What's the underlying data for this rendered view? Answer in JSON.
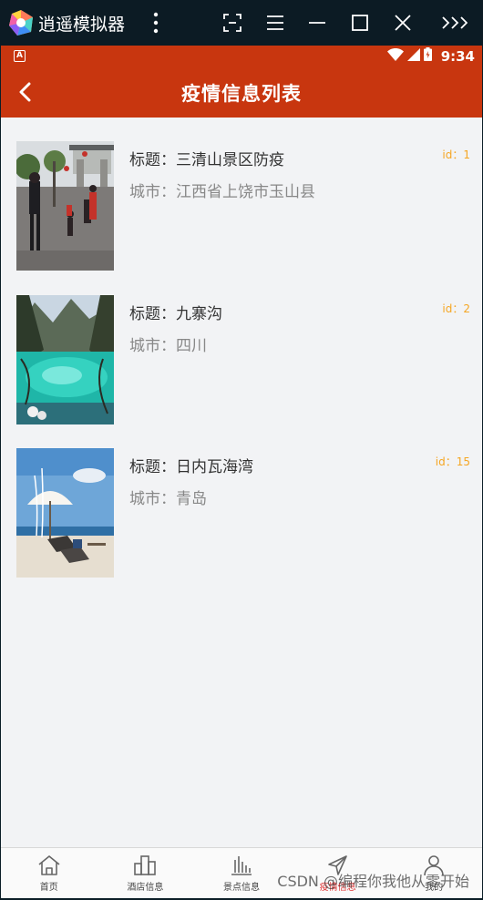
{
  "emulator": {
    "title": "逍遥模拟器",
    "icons": [
      "app-logo-icon",
      "more-vert-icon",
      "screenshot-icon",
      "menu-icon",
      "minimize-icon",
      "maximize-icon",
      "close-icon",
      "expand-icon"
    ]
  },
  "status_bar": {
    "time": "9:34",
    "notification_letter": "A"
  },
  "header": {
    "title": "疫情信息列表"
  },
  "items": [
    {
      "title_label": "标题：",
      "title": "三清山景区防疫",
      "city_label": "城市：",
      "city": "江西省上饶市玉山县",
      "id_label": "id：",
      "id": "1",
      "image": "scenic-square-photo"
    },
    {
      "title_label": "标题：",
      "title": "九寨沟",
      "city_label": "城市：",
      "city": "四川",
      "id_label": "id：",
      "id": "2",
      "image": "lake-valley-photo"
    },
    {
      "title_label": "标题：",
      "title": "日内瓦海湾",
      "city_label": "城市：",
      "city": "青岛",
      "id_label": "id：",
      "id": "15",
      "image": "beach-umbrella-photo"
    }
  ],
  "bottom_nav": [
    {
      "label": "首页",
      "icon": "home-icon",
      "active": false
    },
    {
      "label": "酒店信息",
      "icon": "building-icon",
      "active": false
    },
    {
      "label": "景点信息",
      "icon": "bar-chart-icon",
      "active": false
    },
    {
      "label": "疫情信息",
      "icon": "send-icon",
      "active": true
    },
    {
      "label": "我的",
      "icon": "user-icon",
      "active": false
    }
  ],
  "watermark": "CSDN @编程你我他从零开始",
  "colors": {
    "primary": "#c8360f",
    "accent_id": "#f5a623",
    "active_nav": "#e03030",
    "background": "#f2f3f5"
  }
}
